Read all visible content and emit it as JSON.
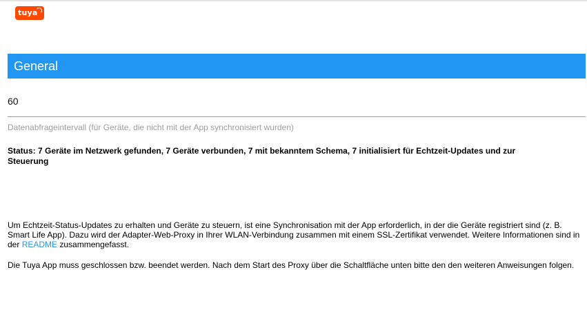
{
  "logo": {
    "text": "tuya"
  },
  "section": {
    "title": "General"
  },
  "interval": {
    "value": "60",
    "hint": "Datenabfrageintervall (für Geräte, die nicht mit der App synchronisiert wurden)"
  },
  "status": {
    "text": "Status: 7 Geräte im Netzwerk gefunden, 7 Geräte verbunden, 7 mit bekanntem Schema, 7 initialisiert für Echtzeit-Updates und zur Steuerung"
  },
  "info": {
    "text_before_link": "Um Echtzeit-Status-Updates zu erhalten und Geräte zu steuern, ist eine Synchronisation mit der App erforderlich, in der die Geräte registriert sind (z. B. Smart Life App). Dazu wird der Adapter-Web-Proxy in Ihrer WLAN-Verbindung zusammen mit einem SSL-Zertifikat verwendet. Weitere Informationen sind in der ",
    "link_text": "README",
    "text_after_link": " zusammengefasst."
  },
  "tuya_app": {
    "text": "Die Tuya App muss geschlossen bzw. beendet werden. Nach dem Start des Proxy über die Schaltfläche unten bitte den den weiteren Anweisungen folgen."
  },
  "colors": {
    "header_bg": "#2196f3",
    "logo_bg": "#ff4800",
    "link": "#2196f3",
    "hint": "#9e9e9e"
  }
}
